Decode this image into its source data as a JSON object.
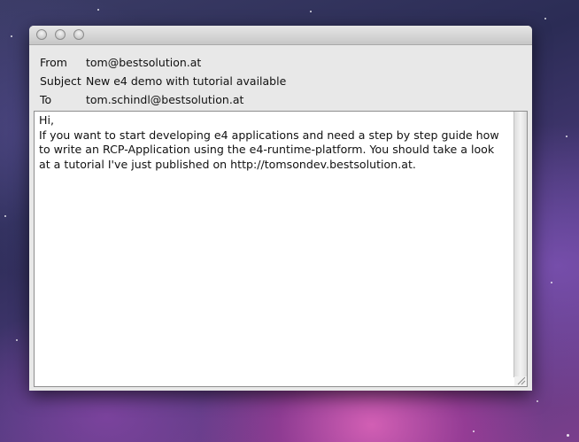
{
  "window": {
    "traffic_lights": [
      "close-button",
      "minimize-button",
      "zoom-button"
    ]
  },
  "headers": {
    "from": {
      "label": "From",
      "value": "tom@bestsolution.at"
    },
    "subject": {
      "label": "Subject",
      "value": "New e4 demo with tutorial available"
    },
    "to": {
      "label": "To",
      "value": "tom.schindl@bestsolution.at"
    }
  },
  "message": {
    "body": "Hi,\nIf you want to start developing e4 applications and need a step by step guide how\nto write an RCP-Application using the e4-runtime-platform. You should take a look\nat a tutorial I've just published on http://tomsondev.bestsolution.at."
  }
}
